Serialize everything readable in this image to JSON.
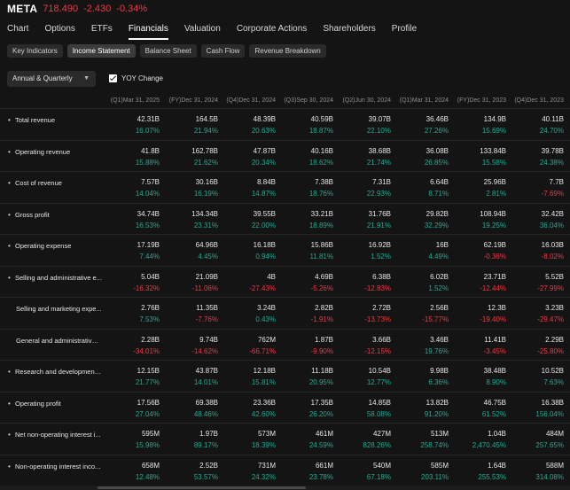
{
  "header": {
    "ticker": "META",
    "price": "718.490",
    "change": "-2.430",
    "change_pct": "-0.34%"
  },
  "tabs": [
    "Chart",
    "Options",
    "ETFs",
    "Financials",
    "Valuation",
    "Corporate Actions",
    "Shareholders",
    "Profile"
  ],
  "active_tab": "Financials",
  "subtabs": [
    "Key Indicators",
    "Income Statement",
    "Balance Sheet",
    "Cash Flow",
    "Revenue Breakdown"
  ],
  "active_subtab": "Income Statement",
  "period_select": {
    "value": "Annual & Quarterly"
  },
  "yoy_toggle": {
    "label": "YOY Change",
    "checked": true
  },
  "columns": [
    "(Q1)Mar 31, 2025",
    "(FY)Dec 31, 2024",
    "(Q4)Dec 31, 2024",
    "(Q3)Sep 30, 2024",
    "(Q2)Jun 30, 2024",
    "(Q1)Mar 31, 2024",
    "(FY)Dec 31, 2023",
    "(Q4)Dec 31, 2023"
  ],
  "rows": [
    {
      "label": "Total revenue",
      "bullet": true,
      "values": [
        "42.31B",
        "164.5B",
        "48.39B",
        "40.59B",
        "39.07B",
        "36.46B",
        "134.9B",
        "40.11B"
      ],
      "yoy": [
        "16.07%",
        "21.94%",
        "20.63%",
        "18.87%",
        "22.10%",
        "27.26%",
        "15.69%",
        "24.70%"
      ]
    },
    {
      "label": "Operating revenue",
      "bullet": true,
      "values": [
        "41.8B",
        "162.78B",
        "47.87B",
        "40.16B",
        "38.68B",
        "36.08B",
        "133.84B",
        "39.78B"
      ],
      "yoy": [
        "15.88%",
        "21.62%",
        "20.34%",
        "18.62%",
        "21.74%",
        "26.85%",
        "15.58%",
        "24.38%"
      ]
    },
    {
      "label": "Cost of revenue",
      "bullet": true,
      "values": [
        "7.57B",
        "30.16B",
        "8.84B",
        "7.38B",
        "7.31B",
        "6.64B",
        "25.96B",
        "7.7B"
      ],
      "yoy": [
        "14.04%",
        "16.19%",
        "14.87%",
        "18.76%",
        "22.93%",
        "8.71%",
        "2.81%",
        "-7.69%"
      ]
    },
    {
      "label": "Gross profit",
      "bullet": true,
      "values": [
        "34.74B",
        "134.34B",
        "39.55B",
        "33.21B",
        "31.76B",
        "29.82B",
        "108.94B",
        "32.42B"
      ],
      "yoy": [
        "16.53%",
        "23.31%",
        "22.00%",
        "18.89%",
        "21.91%",
        "32.29%",
        "19.25%",
        "36.04%"
      ]
    },
    {
      "label": "Operating expense",
      "bullet": true,
      "values": [
        "17.19B",
        "64.96B",
        "16.18B",
        "15.86B",
        "16.92B",
        "16B",
        "62.19B",
        "16.03B"
      ],
      "yoy": [
        "7.44%",
        "4.45%",
        "0.94%",
        "11.81%",
        "1.52%",
        "4.49%",
        "-0.36%",
        "-8.02%"
      ]
    },
    {
      "label": "Selling and administrative e...",
      "bullet": true,
      "values": [
        "5.04B",
        "21.09B",
        "4B",
        "4.69B",
        "6.38B",
        "6.02B",
        "23.71B",
        "5.52B"
      ],
      "yoy": [
        "-16.32%",
        "-11.06%",
        "-27.43%",
        "-5.26%",
        "-12.83%",
        "1.52%",
        "-12.44%",
        "-27.99%"
      ]
    },
    {
      "label": "Selling and marketing expe...",
      "bullet": false,
      "values": [
        "2.76B",
        "11.35B",
        "3.24B",
        "2.82B",
        "2.72B",
        "2.56B",
        "12.3B",
        "3.23B"
      ],
      "yoy": [
        "7.53%",
        "-7.76%",
        "0.43%",
        "-1.91%",
        "-13.73%",
        "-15.77%",
        "-19.40%",
        "-29.47%"
      ]
    },
    {
      "label": "General and administrative ...",
      "bullet": false,
      "values": [
        "2.28B",
        "9.74B",
        "762M",
        "1.87B",
        "3.66B",
        "3.46B",
        "11.41B",
        "2.29B"
      ],
      "yoy": [
        "-34.01%",
        "-14.62%",
        "-66.71%",
        "-9.90%",
        "-12.15%",
        "19.76%",
        "-3.45%",
        "-25.80%"
      ]
    },
    {
      "label": "Research and development ...",
      "bullet": true,
      "values": [
        "12.15B",
        "43.87B",
        "12.18B",
        "11.18B",
        "10.54B",
        "9.98B",
        "38.48B",
        "10.52B"
      ],
      "yoy": [
        "21.77%",
        "14.01%",
        "15.81%",
        "20.95%",
        "12.77%",
        "6.36%",
        "8.90%",
        "7.63%"
      ]
    },
    {
      "label": "Operating profit",
      "bullet": true,
      "values": [
        "17.56B",
        "69.38B",
        "23.36B",
        "17.35B",
        "14.85B",
        "13.82B",
        "46.75B",
        "16.38B"
      ],
      "yoy": [
        "27.04%",
        "48.46%",
        "42.60%",
        "26.20%",
        "58.08%",
        "91.20%",
        "61.52%",
        "156.04%"
      ]
    },
    {
      "label": "Net non-operating interest i...",
      "bullet": true,
      "values": [
        "595M",
        "1.97B",
        "573M",
        "461M",
        "427M",
        "513M",
        "1.04B",
        "484M"
      ],
      "yoy": [
        "15.98%",
        "89.17%",
        "18.39%",
        "24.59%",
        "828.26%",
        "258.74%",
        "2,470.45%",
        "257.65%"
      ]
    },
    {
      "label": "Non-operating interest inco...",
      "bullet": true,
      "values": [
        "658M",
        "2.52B",
        "731M",
        "661M",
        "540M",
        "585M",
        "1.64B",
        "588M"
      ],
      "yoy": [
        "12.48%",
        "53.57%",
        "24.32%",
        "23.78%",
        "67.18%",
        "203.11%",
        "255.53%",
        "314.08%"
      ]
    }
  ]
}
